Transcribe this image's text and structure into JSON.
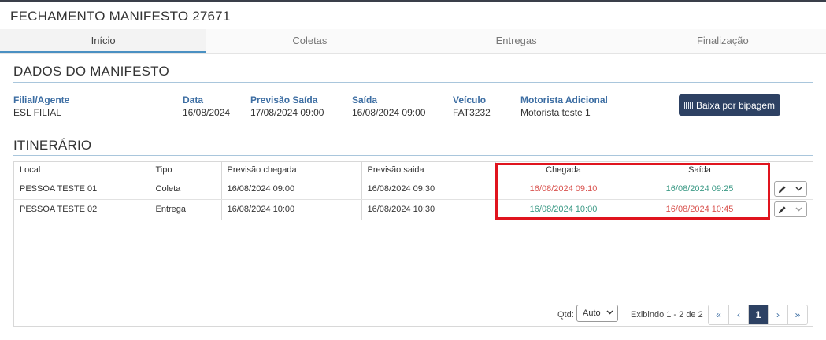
{
  "page_title": "FECHAMENTO MANIFESTO 27671",
  "tabs": [
    {
      "label": "Início",
      "active": true
    },
    {
      "label": "Coletas",
      "active": false
    },
    {
      "label": "Entregas",
      "active": false
    },
    {
      "label": "Finalização",
      "active": false
    }
  ],
  "dados": {
    "title": "DADOS DO MANIFESTO",
    "fields": {
      "filial": {
        "label": "Filial/Agente",
        "value": "ESL FILIAL"
      },
      "data": {
        "label": "Data",
        "value": "16/08/2024"
      },
      "previsao_saida": {
        "label": "Previsão Saída",
        "value": "17/08/2024 09:00"
      },
      "saida": {
        "label": "Saída",
        "value": "16/08/2024 09:00"
      },
      "veiculo": {
        "label": "Veículo",
        "value": "FAT3232"
      },
      "motorista": {
        "label": "Motorista Adicional",
        "value": "Motorista teste 1"
      }
    },
    "baixa_button": "Baixa por bipagem"
  },
  "itinerario": {
    "title": "ITINERÁRIO",
    "columns": [
      "Local",
      "Tipo",
      "Previsão chegada",
      "Previsão saida",
      "Chegada",
      "Saída"
    ],
    "rows": [
      {
        "local": "PESSOA TESTE 01",
        "tipo": "Coleta",
        "prev_chegada": "16/08/2024 09:00",
        "prev_saida": "16/08/2024 09:30",
        "chegada": "16/08/2024 09:10",
        "chegada_status": "late",
        "saida": "16/08/2024 09:25",
        "saida_status": "ontime"
      },
      {
        "local": "PESSOA TESTE 02",
        "tipo": "Entrega",
        "prev_chegada": "16/08/2024 10:00",
        "prev_saida": "16/08/2024 10:30",
        "chegada": "16/08/2024 10:00",
        "chegada_status": "ontime",
        "saida": "16/08/2024 10:45",
        "saida_status": "late"
      }
    ]
  },
  "pager": {
    "qtd_label": "Qtd:",
    "qtd_value": "Auto",
    "showing": "Exibindo 1 - 2 de 2",
    "first": "«",
    "prev": "‹",
    "page": "1",
    "next": "›",
    "last": "»"
  },
  "colors": {
    "late": "#d9534f",
    "ontime": "#3c9a86",
    "primary": "#2d4163",
    "label_blue": "#3d6ea3",
    "highlight": "#e0141e"
  },
  "icons": {
    "edit": "pencil-icon",
    "dropdown": "chevron-down-icon",
    "barcode": "barcode-icon"
  }
}
